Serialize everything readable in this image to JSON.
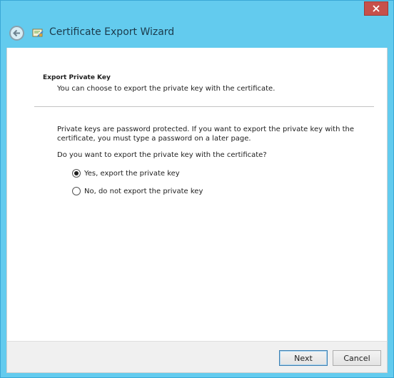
{
  "window": {
    "title": "Certificate Export Wizard",
    "accent_color": "#63cbee",
    "close_color": "#c7504b"
  },
  "icons": {
    "close": "close-icon",
    "back": "back-arrow-icon",
    "app": "certificate-icon"
  },
  "page": {
    "heading": "Export Private Key",
    "subheading": "You can choose to export the private key with the certificate.",
    "info_line1": "Private keys are password protected. If you want to export the private key with the",
    "info_line2": "certificate, you must type a password on a later page.",
    "question": "Do you want to export the private key with the certificate?",
    "options": [
      {
        "label": "Yes, export the private key",
        "selected": true
      },
      {
        "label": "No, do not export the private key",
        "selected": false
      }
    ]
  },
  "footer": {
    "next_label": "Next",
    "cancel_label": "Cancel"
  }
}
